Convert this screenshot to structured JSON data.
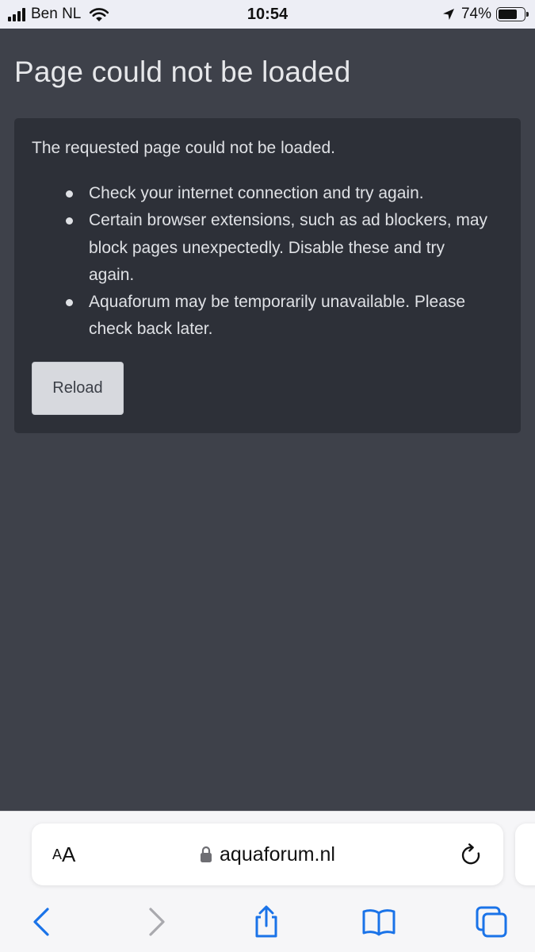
{
  "status_bar": {
    "carrier": "Ben NL",
    "time": "10:54",
    "battery_percent": "74%",
    "battery_level": 0.74,
    "icons": [
      "signal-icon",
      "wifi-icon",
      "location-arrow-icon",
      "battery-icon"
    ]
  },
  "page": {
    "title": "Page could not be loaded",
    "intro": "The requested page could not be loaded.",
    "tips": [
      "Check your internet connection and try again.",
      "Certain browser extensions, such as ad blockers, may block pages unexpectedly. Disable these and try again.",
      "Aquaforum may be temporarily unavailable. Please check back later."
    ],
    "reload_label": "Reload"
  },
  "browser": {
    "text_size_small": "A",
    "text_size_large": "A",
    "url": "aquaforum.nl",
    "icons": [
      "lock-icon",
      "reload-icon",
      "back-icon",
      "forward-icon",
      "share-icon",
      "bookmarks-icon",
      "tabs-icon"
    ]
  },
  "colors": {
    "page_background": "#3e414a",
    "card_background": "#2d3038",
    "title_text": "#e6e7ea",
    "body_text": "#dfe1e5",
    "button_background": "#d7d9de",
    "toolbar_accent": "#1a73e8"
  }
}
